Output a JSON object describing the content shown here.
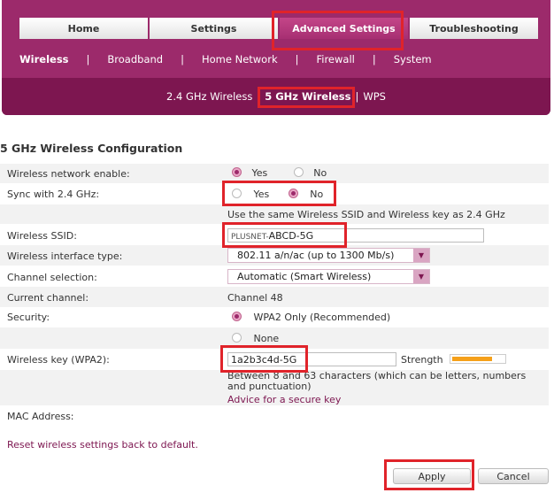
{
  "tabs": [
    "Home",
    "Settings",
    "Advanced Settings",
    "Troubleshooting"
  ],
  "subnav": [
    "Wireless",
    "Broadband",
    "Home Network",
    "Firewall",
    "System"
  ],
  "subnav_separator": "|",
  "subsubnav": [
    "2.4 GHz Wireless",
    "5 GHz Wireless",
    "WPS"
  ],
  "page_title": "5 GHz Wireless Configuration",
  "rows": {
    "enable": {
      "label": "Wireless network enable:",
      "opt_yes": "Yes",
      "opt_no": "No",
      "selected": "Yes"
    },
    "sync": {
      "label": "Sync with 2.4 GHz:",
      "opt_yes": "Yes",
      "opt_no": "No",
      "selected": "No"
    },
    "sync_hint": "Use the same Wireless SSID and Wireless key as 2.4 GHz",
    "ssid": {
      "label": "Wireless SSID:",
      "prefix": "PLUSNET-",
      "value": "ABCD-5G"
    },
    "iface": {
      "label": "Wireless interface type:",
      "value": "802.11 a/n/ac (up to 1300 Mb/s)"
    },
    "channel_sel": {
      "label": "Channel selection:",
      "value": "Automatic (Smart Wireless)"
    },
    "current_channel": {
      "label": "Current channel:",
      "value": "Channel 48"
    },
    "security": {
      "label": "Security:",
      "opt_wpa2": "WPA2 Only (Recommended)",
      "opt_none": "None",
      "selected": "WPA2 Only (Recommended)"
    },
    "key": {
      "label": "Wireless key (WPA2):",
      "value": "1a2b3c4d-5G",
      "strength_label": "Strength",
      "strength_level": 0.78
    },
    "key_hint": "Between 8 and 63 characters (which can be letters, numbers and punctuation)",
    "key_advice": "Advice for a secure key",
    "mac": {
      "label": "MAC Address:"
    }
  },
  "reset_link": "Reset wireless settings back to default.",
  "buttons": {
    "apply": "Apply",
    "cancel": "Cancel"
  },
  "colors": {
    "brand": "#9c2a6b",
    "brand_dark": "#7d1650",
    "highlight": "#e0232a",
    "strength": "#f5a01a"
  }
}
